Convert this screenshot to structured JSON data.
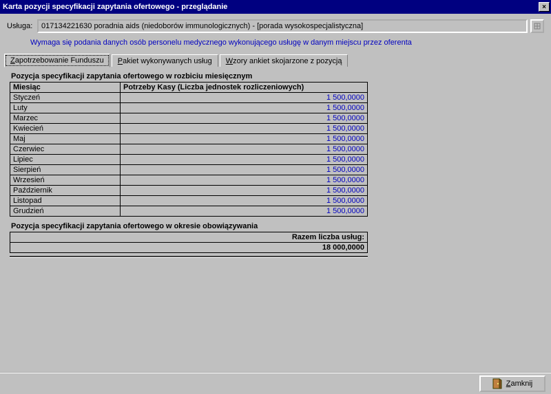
{
  "window": {
    "title": "Karta pozycji specyfikacji zapytania ofertowego - przeglądanie",
    "close_symbol": "×"
  },
  "usluga": {
    "label": "Usługa:",
    "value": "017134221630 poradnia aids (niedoborów immunologicznych) - [porada wysokospecjalistyczna]"
  },
  "notice": "Wymaga się podania danych osób personelu medycznego wykonującego usługę w danym miejscu przez oferenta",
  "tabs": {
    "fund_prefix": "Z",
    "fund_rest": "apotrzebowanie Funduszu",
    "pakiet_prefix": "P",
    "pakiet_rest": "akiet wykonywanych usług",
    "ankiety_prefix": "W",
    "ankiety_rest": "zory ankiet skojarzone z pozycją"
  },
  "grid": {
    "heading": "Pozycja specyfikacji zapytania ofertowego w rozbiciu miesięcznym",
    "col_month": "Miesiąc",
    "col_value": "Potrzeby Kasy (Liczba jednostek rozliczeniowych)",
    "rows": [
      {
        "m": "Styczeń",
        "v": "1 500,0000"
      },
      {
        "m": "Luty",
        "v": "1 500,0000"
      },
      {
        "m": "Marzec",
        "v": "1 500,0000"
      },
      {
        "m": "Kwiecień",
        "v": "1 500,0000"
      },
      {
        "m": "Maj",
        "v": "1 500,0000"
      },
      {
        "m": "Czerwiec",
        "v": "1 500,0000"
      },
      {
        "m": "Lipiec",
        "v": "1 500,0000"
      },
      {
        "m": "Sierpień",
        "v": "1 500,0000"
      },
      {
        "m": "Wrzesień",
        "v": "1 500,0000"
      },
      {
        "m": "Październik",
        "v": "1 500,0000"
      },
      {
        "m": "Listopad",
        "v": "1 500,0000"
      },
      {
        "m": "Grudzień",
        "v": "1 500,0000"
      }
    ]
  },
  "summary": {
    "heading": "Pozycja specyfikacji zapytania ofertowego w okresie obowiązywania",
    "label": "Razem liczba usług:",
    "value": "18 000,0000"
  },
  "footer": {
    "close_prefix": "Z",
    "close_rest": "amknij"
  }
}
